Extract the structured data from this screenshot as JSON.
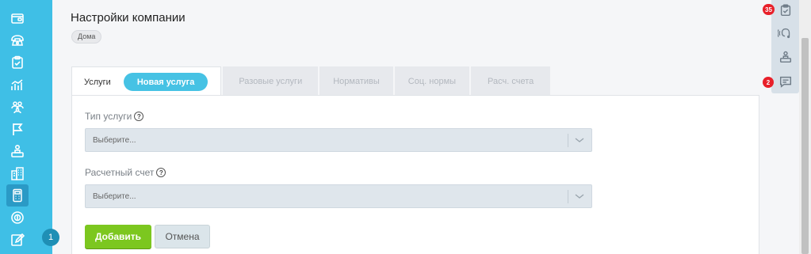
{
  "sidebar": {
    "items": [
      {
        "icon": "wallet-icon"
      },
      {
        "icon": "phone-icon"
      },
      {
        "icon": "clipboard-check-icon"
      },
      {
        "icon": "analytics-icon"
      },
      {
        "icon": "users-icon"
      },
      {
        "icon": "flag-icon"
      },
      {
        "icon": "inspector-icon"
      },
      {
        "icon": "building-icon"
      },
      {
        "icon": "calculator-icon",
        "active": true
      },
      {
        "icon": "coin-icon"
      },
      {
        "icon": "edit-icon"
      }
    ],
    "badge": "1"
  },
  "page": {
    "title": "Настройки компании",
    "tag": "Дома"
  },
  "tabs": {
    "items": [
      {
        "label": "Услуги"
      },
      {
        "label": "Разовые услуги"
      },
      {
        "label": "Нормативы"
      },
      {
        "label": "Соц. нормы"
      },
      {
        "label": "Расч. счета"
      }
    ],
    "new_button": "Новая услуга"
  },
  "form": {
    "service_type": {
      "label": "Тип услуги",
      "placeholder": "Выберите..."
    },
    "account": {
      "label": "Расчетный счет",
      "placeholder": "Выберите..."
    },
    "add_label": "Добавить",
    "cancel_label": "Отмена"
  },
  "right_panel": {
    "tasks_badge": "35",
    "messages_badge": "2"
  },
  "colors": {
    "sidebar": "#3fbfe6",
    "accent": "#46c2e4",
    "add_button": "#7cc71f",
    "badge": "#e8202a"
  }
}
